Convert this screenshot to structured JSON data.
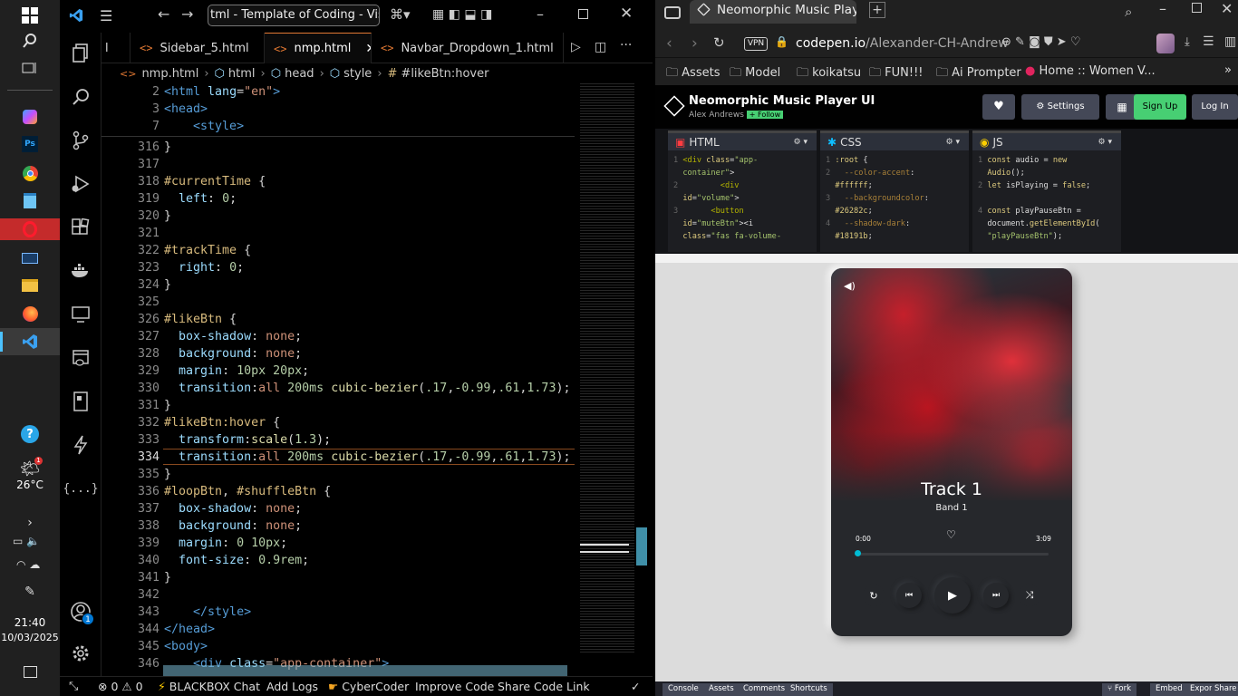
{
  "taskbar": {
    "weather_temp": "26°C",
    "clock_time": "21:40",
    "clock_date": "10/03/2025",
    "account_badge": "1",
    "weather_badge": "1"
  },
  "vscode": {
    "title": "tml - Template of Coding - Visual St",
    "tabs": [
      "Sidebar_5.html",
      "nmp.html",
      "Navbar_Dropdown_1.html"
    ],
    "tab_partial": "l",
    "tab_icon": "<>",
    "breadcrumb": [
      "nmp.html",
      "html",
      "head",
      "style",
      "#likeBtn:hover"
    ],
    "status": {
      "errors": "0",
      "warnings": "0",
      "blackbox": "BLACKBOX Chat",
      "add_logs": "Add Logs",
      "cybercoder": "CyberCoder",
      "improve": "Improve Code",
      "share": "Share Code Link"
    }
  },
  "browser": {
    "tab_title": "Neomorphic Music Player",
    "url_domain": "codepen.io",
    "url_path": "/Alexander-CH-Andrew",
    "vpn_label": "VPN",
    "bookmarks": [
      "Assets",
      "Model",
      "koikatsu",
      "FUN!!!",
      "Ai Prompter",
      "Home :: Women V..."
    ],
    "codepen": {
      "title": "Neomorphic Music Player UI",
      "author": "Alex Andrews",
      "follow": "+ Follow",
      "settings": "Settings",
      "signup": "Sign Up",
      "login": "Log In",
      "panes": [
        "HTML",
        "CSS",
        "JS"
      ],
      "footer": [
        "Console",
        "Assets",
        "Comments",
        "Shortcuts",
        "Fork",
        "Embed",
        "Export",
        "Share"
      ]
    },
    "player": {
      "track": "Track 1",
      "band": "Band 1",
      "current_time": "0:00",
      "duration": "3:09",
      "progress": 0.0
    }
  }
}
